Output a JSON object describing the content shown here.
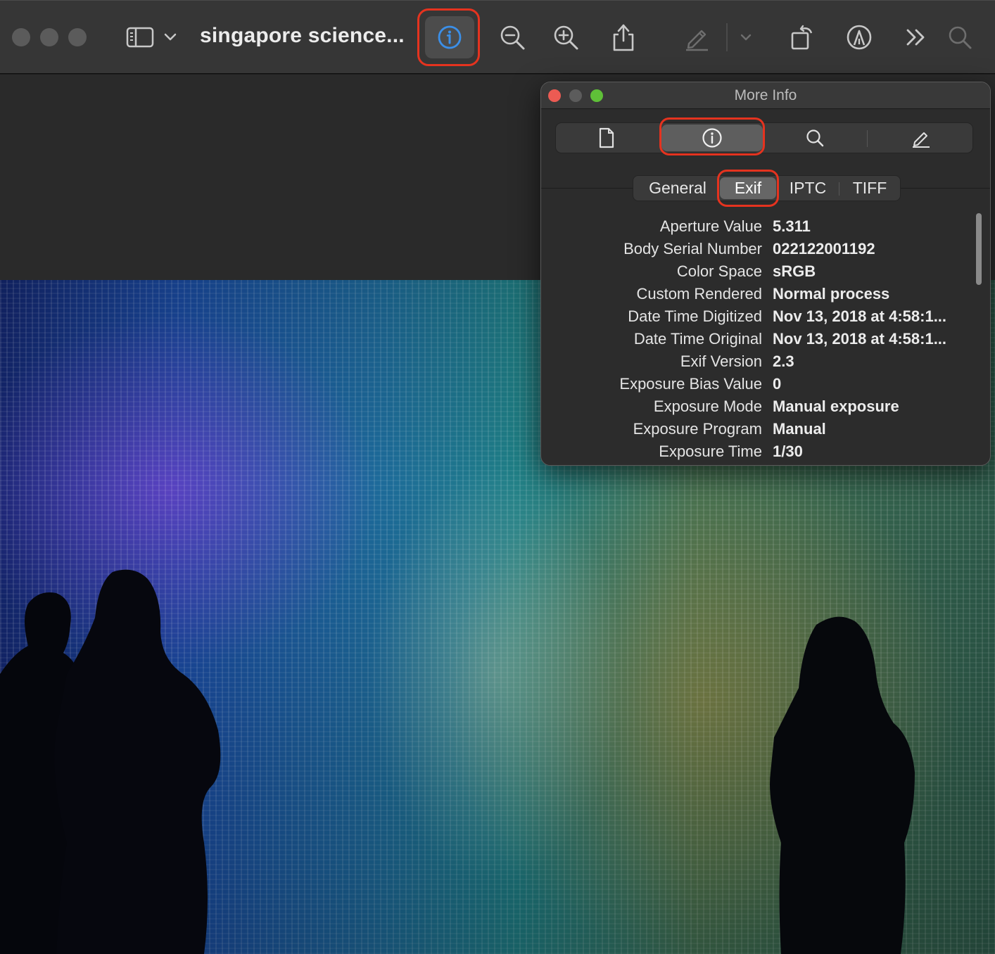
{
  "window": {
    "document_title": "singapore science...",
    "accent": "#3b8fe8",
    "highlight_color": "#e5331f"
  },
  "toolbar": {
    "icons": [
      "sidebar-icon",
      "chevron-down-icon",
      "info-icon",
      "zoom-out-icon",
      "zoom-in-icon",
      "share-icon",
      "markup-pen-icon",
      "chevron-down-icon",
      "rotate-icon",
      "annotate-icon",
      "more-chevrons-icon",
      "search-icon"
    ]
  },
  "panel": {
    "title": "More Info",
    "inspector_tabs": [
      "document-icon",
      "info-icon",
      "search-icon",
      "pen-icon"
    ],
    "tabs": {
      "general": "General",
      "exif": "Exif",
      "iptc": "IPTC",
      "tiff": "TIFF"
    },
    "rows": [
      {
        "key": "Aperture Value",
        "value": "5.311"
      },
      {
        "key": "Body Serial Number",
        "value": "022122001192"
      },
      {
        "key": "Color Space",
        "value": "sRGB"
      },
      {
        "key": "Custom Rendered",
        "value": "Normal process"
      },
      {
        "key": "Date Time Digitized",
        "value": "Nov 13, 2018 at 4:58:1..."
      },
      {
        "key": "Date Time Original",
        "value": "Nov 13, 2018 at 4:58:1..."
      },
      {
        "key": "Exif Version",
        "value": "2.3"
      },
      {
        "key": "Exposure Bias Value",
        "value": "0"
      },
      {
        "key": "Exposure Mode",
        "value": "Manual exposure"
      },
      {
        "key": "Exposure Program",
        "value": "Manual"
      },
      {
        "key": "Exposure Time",
        "value": "1/30"
      }
    ]
  }
}
